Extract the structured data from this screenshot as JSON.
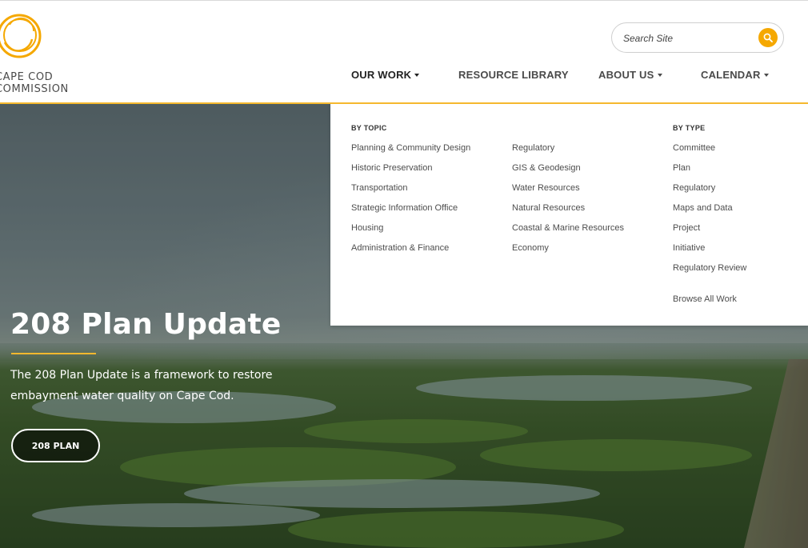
{
  "logo": {
    "line1": "CAPE COD",
    "line2": "COMMISSION",
    "ring_color": "#f5a800"
  },
  "search": {
    "placeholder": "Search Site",
    "icon": "search-icon"
  },
  "nav": {
    "our_work": "OUR WORK",
    "resource_library": "RESOURCE LIBRARY",
    "about_us": "ABOUT US",
    "calendar": "CALENDAR"
  },
  "mega_menu": {
    "by_topic_heading": "BY TOPIC",
    "by_type_heading": "BY TYPE",
    "topic_col1": [
      "Planning & Community Design",
      "Historic Preservation",
      "Transportation",
      "Strategic Information Office",
      "Housing",
      "Administration & Finance"
    ],
    "topic_col2": [
      "Regulatory",
      "GIS & Geodesign",
      "Water Resources",
      "Natural Resources",
      "Coastal & Marine Resources",
      "Economy"
    ],
    "type_col": [
      "Committee",
      "Plan",
      "Regulatory",
      "Maps and Data",
      "Project",
      "Initiative",
      "Regulatory Review"
    ],
    "browse_all": "Browse All Work"
  },
  "hero": {
    "title": "208 Plan Update",
    "description": "The 208 Plan Update is a framework to restore embayment water quality on Cape Cod.",
    "button_label": "208 PLAN"
  },
  "colors": {
    "accent": "#f5b82e",
    "search_button": "#f5a800"
  }
}
